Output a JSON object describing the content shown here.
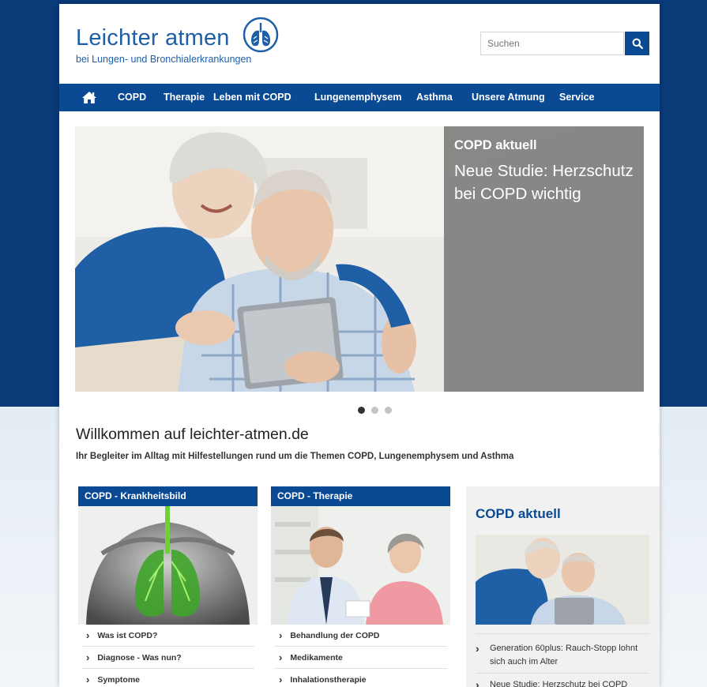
{
  "header": {
    "logo_title": "Leichter atmen",
    "logo_subtitle": "bei Lungen- und Bronchialerkrankungen",
    "logo_icon": "lungs-icon",
    "search_placeholder": "Suchen",
    "search_icon": "search-icon"
  },
  "nav": {
    "home_icon": "home-icon",
    "items": [
      "COPD",
      "Therapie",
      "Leben mit COPD",
      "Lungenemphysem",
      "Asthma",
      "Unsere Atmung",
      "Service"
    ]
  },
  "hero": {
    "kicker": "COPD aktuell",
    "headline": "Neue Studie: Herzschutz bei COPD wichtig",
    "slides_total": 3,
    "active_slide": 1
  },
  "welcome": {
    "title": "Willkommen auf leichter-atmen.de",
    "tagline": "Ihr Begleiter im Alltag mit Hilfestellungen rund um die Themen COPD, Lungenemphysem und Asthma"
  },
  "cards": [
    {
      "title": "COPD - Krankheitsbild",
      "links": [
        "Was ist COPD?",
        "Diagnose - Was nun?",
        "Symptome"
      ]
    },
    {
      "title": "COPD - Therapie",
      "links": [
        "Behandlung der COPD",
        "Medikamente",
        "Inhalationstherapie"
      ]
    }
  ],
  "aside": {
    "title": "COPD aktuell",
    "items": [
      "Generation 60plus: Rauch-Stopp lohnt sich auch im Alter",
      "Neue Studie: Herzschutz bei COPD"
    ]
  },
  "colors": {
    "brand_blue": "#0a4a94",
    "logo_blue": "#1f5fa6",
    "background_navy": "#0a3a78",
    "hero_panel_gray": "#808080"
  }
}
